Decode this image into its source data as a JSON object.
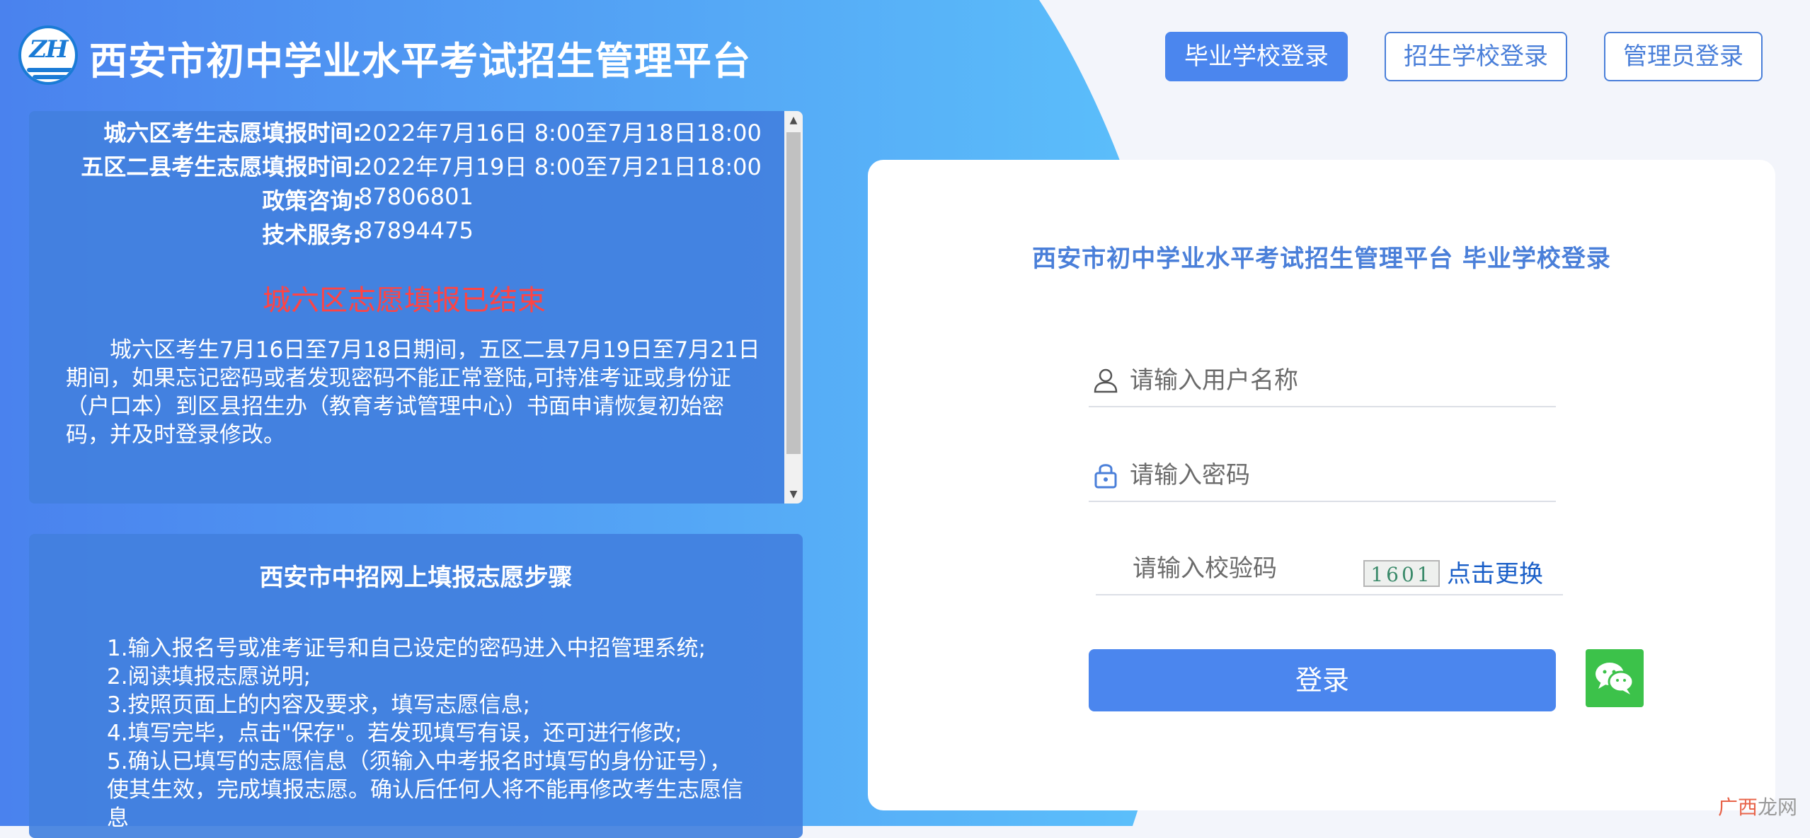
{
  "header": {
    "logo_text": "ZH",
    "site_title": "西安市初中学业水平考试招生管理平台",
    "nav": [
      {
        "label": "毕业学校登录"
      },
      {
        "label": "招生学校登录"
      },
      {
        "label": "管理员登录"
      }
    ]
  },
  "notice": {
    "rows": [
      {
        "label": "城六区考生志愿填报时间:",
        "value": "2022年7月16日 8:00至7月18日18:00"
      },
      {
        "label": "五区二县考生志愿填报时间:",
        "value": "2022年7月19日 8:00至7月21日18:00"
      },
      {
        "label": "政策咨询:",
        "value": "87806801"
      },
      {
        "label": "技术服务:",
        "value": "87894475"
      }
    ],
    "closed_message": "城六区志愿填报已结束",
    "body": "城六区考生7月16日至7月18日期间，五区二县7月19日至7月21日期间，如果忘记密码或者发现密码不能正常登陆,可持准考证或身份证（户口本）到区县招生办（教育考试管理中心）书面申请恢复初始密码，并及时登录修改。"
  },
  "steps": {
    "title": "西安市中招网上填报志愿步骤",
    "items": [
      "1.输入报名号或准考证号和自己设定的密码进入中招管理系统;",
      "2.阅读填报志愿说明;",
      "3.按照页面上的内容及要求，填写志愿信息;",
      "4.填写完毕，点击\"保存\"。若发现填写有误，还可进行修改;",
      "5.确认已填写的志愿信息（须输入中考报名时填写的身份证号），使其生效，完成填报志愿。确认后任何人将不能再修改考生志愿信息"
    ]
  },
  "login": {
    "heading": "西安市初中学业水平考试招生管理平台 毕业学校登录",
    "username_placeholder": "请输入用户名称",
    "password_placeholder": "请输入密码",
    "captcha_placeholder": "请输入校验码",
    "captcha_code": "1601",
    "captcha_refresh": "点击更换",
    "submit_label": "登录"
  },
  "watermark": {
    "brand": "广西",
    "suffix": "龙网"
  }
}
